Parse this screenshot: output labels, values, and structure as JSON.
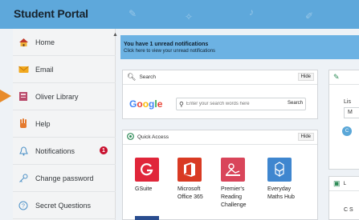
{
  "header": {
    "title": "Student Portal"
  },
  "sidebar": {
    "items": [
      {
        "label": "Home",
        "icon": "home-icon"
      },
      {
        "label": "Email",
        "icon": "email-icon"
      },
      {
        "label": "Oliver Library",
        "icon": "library-icon"
      },
      {
        "label": "Help",
        "icon": "help-icon"
      },
      {
        "label": "Notifications",
        "icon": "bell-icon",
        "badge": "1"
      },
      {
        "label": "Change password",
        "icon": "key-icon"
      },
      {
        "label": "Secret Questions",
        "icon": "question-icon"
      }
    ]
  },
  "notification": {
    "title": "You have 1 unread notifications",
    "subtitle": "Click here to view your unread notifications"
  },
  "search_panel": {
    "title": "Search",
    "hide_label": "Hide",
    "logo": "Google",
    "placeholder": "Enter your search words here",
    "button": "Search"
  },
  "quick_access": {
    "title": "Quick Access",
    "hide_label": "Hide",
    "tiles": [
      {
        "label": "GSuite",
        "glyph": "G",
        "color": "#e0263a"
      },
      {
        "label": "Microsoft Office 365",
        "glyph": "O",
        "color": "#d93a23"
      },
      {
        "label": "Premier's Reading Challenge",
        "glyph": "☺",
        "color": "#d9455a"
      },
      {
        "label": "Everyday Maths Hub",
        "glyph": "◈",
        "color": "#3f86cf"
      }
    ]
  },
  "right_panel": {
    "input_value": "M",
    "partial_label": "Lis",
    "bottom_label": "L",
    "bottom_text": "C S"
  },
  "colors": {
    "header": "#5ea8db",
    "notification": "#6cb2e3",
    "badge": "#c8102e",
    "arrow": "#e88b2a"
  }
}
